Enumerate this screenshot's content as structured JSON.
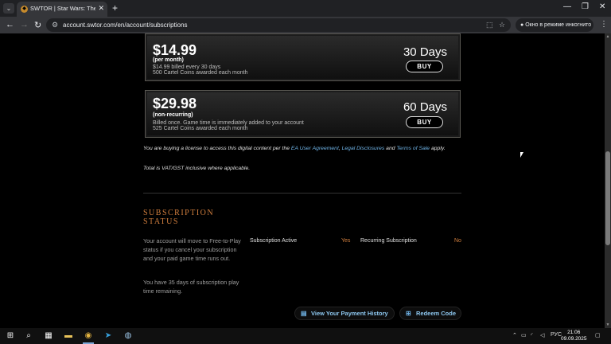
{
  "browser": {
    "tab_title": "SWTOR | Star Wars: The Old Re",
    "url": "account.swtor.com/en/account/subscriptions",
    "incognito_label": "Окно в режиме инкогнито"
  },
  "plans": [
    {
      "price": "$14.99",
      "period": "(per month)",
      "desc1": "$14.99 billed every 30 days",
      "desc2": "500 Cartel Coins awarded each month",
      "days": "30 Days",
      "buy_label": "BUY"
    },
    {
      "price": "$29.98",
      "period": "(non-recurring)",
      "desc1": "Billed once. Game time is immediately added to your account",
      "desc2": "525 Cartel Coins awarded each month",
      "days": "60 Days",
      "buy_label": "BUY"
    }
  ],
  "legal": {
    "prefix": "You are buying a license to access this digital content per the",
    "link1": "EA User Agreement",
    "sep": ",",
    "link2": "Legal Disclosures",
    "and": "and",
    "link3": "Terms of Sale",
    "suffix": "apply.",
    "vat": "Total is VAT/GST inclusive where applicable."
  },
  "subscription_status": {
    "title": "SUBSCRIPTION STATUS",
    "note1": "Your account will move to Free-to-Play status if you cancel your subscription and your paid game time runs out.",
    "note2": "You have 35 days of subscription play time remaining.",
    "active_label": "Subscription Active",
    "active_value": "Yes",
    "recurring_label": "Recurring Subscription",
    "recurring_value": "No",
    "payment_history": "View Your Payment History",
    "redeem_code": "Redeem Code"
  },
  "taskbar": {
    "lang": "РУС",
    "time": "21:06",
    "date": "09.09.2025"
  },
  "colors": {
    "accent_orange": "#d27f3e",
    "link_blue": "#6fb3e6"
  }
}
